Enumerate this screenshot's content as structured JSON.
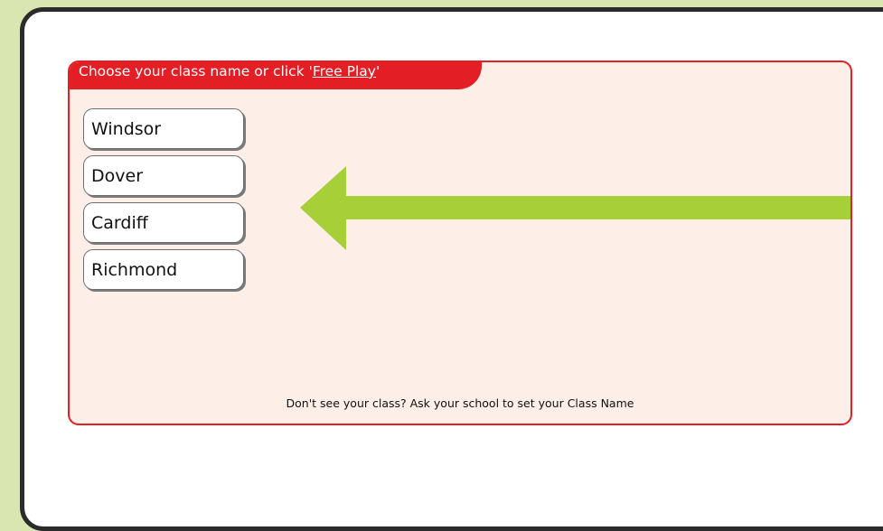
{
  "header": {
    "prefix": "Choose your class name or click '",
    "link_label": "Free Play",
    "suffix": "'"
  },
  "classes": [
    {
      "label": "Windsor"
    },
    {
      "label": "Dover"
    },
    {
      "label": "Cardiff"
    },
    {
      "label": "Richmond"
    }
  ],
  "footer": {
    "note": "Don't see your class? Ask your school to set your Class Name"
  },
  "colors": {
    "accent": "#e31e24",
    "panel_background": "#fdeee8",
    "arrow": "#a6cf38",
    "page_background": "#d9e6b2"
  },
  "icons": {
    "arrow": "arrow-left-icon"
  }
}
